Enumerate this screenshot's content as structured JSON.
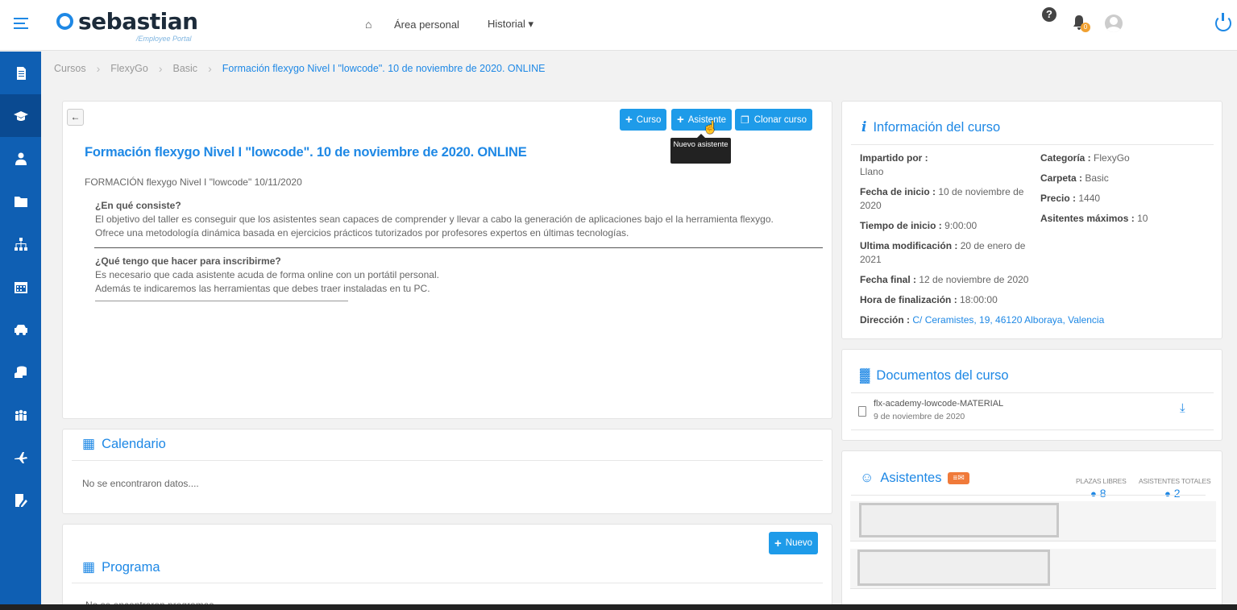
{
  "header": {
    "logo_name": "sebastian",
    "logo_sub": "/Employee Portal",
    "nav": [
      {
        "label": "Área personal"
      },
      {
        "label": "Historial ▾"
      }
    ],
    "help_label": "?",
    "notification_count": "0"
  },
  "sidebar": {
    "items": [
      {
        "icon": "document-icon"
      },
      {
        "icon": "graduation-cap-icon",
        "active": true
      },
      {
        "icon": "user-icon"
      },
      {
        "icon": "folder-icon"
      },
      {
        "icon": "org-chart-icon"
      },
      {
        "icon": "calendar-icon"
      },
      {
        "icon": "car-icon"
      },
      {
        "icon": "coins-icon"
      },
      {
        "icon": "team-icon"
      },
      {
        "icon": "plane-icon"
      },
      {
        "icon": "edit-document-icon"
      }
    ]
  },
  "breadcrumb": {
    "items": [
      "Cursos",
      "FlexyGo",
      "Basic"
    ],
    "current": "Formación flexygo Nivel I \"lowcode\". 10 de noviembre de 2020. ONLINE"
  },
  "course": {
    "buttons": {
      "curso": "Curso",
      "asistente": "Asistente",
      "clonar": "Clonar curso"
    },
    "tooltip": "Nuevo asistente",
    "title": "Formación flexygo Nivel I \"lowcode\". 10 de noviembre de 2020. ONLINE",
    "subtitle": "FORMACIÓN flexygo Nivel I \"lowcode\" 10/11/2020",
    "q1": "¿En qué consiste?",
    "a1_line1": "El objetivo del taller es conseguir que los asistentes sean capaces de comprender y llevar a cabo la generación de aplicaciones bajo el la herramienta flexygo.",
    "a1_line2": "Ofrece una metodología dinámica basada en ejercicios prácticos tutorizados por profesores expertos en últimas tecnologías.",
    "q2": "¿Qué tengo que hacer para inscribirme?",
    "a2_line1": "Es necesario que cada asistente acuda de forma online con un portátil personal.",
    "a2_line2": "Además te indicaremos las herramientas que debes traer instaladas en tu PC."
  },
  "calendar": {
    "title": "Calendario",
    "empty": "No se encontraron datos...."
  },
  "program": {
    "title": "Programa",
    "new_button": "Nuevo",
    "empty": "No se encontraron programas"
  },
  "info": {
    "title": "Información del curso",
    "left": [
      {
        "label": "Impartido por :",
        "value": "Llano"
      },
      {
        "label": "Fecha de inicio :",
        "value": "10 de noviembre de 2020"
      },
      {
        "label": "Tiempo de inicio :",
        "value": "9:00:00"
      },
      {
        "label": "Ultima modificación :",
        "value": "20 de enero de 2021"
      },
      {
        "label": "Fecha final :",
        "value": "12 de noviembre de 2020"
      },
      {
        "label": "Hora de finalización :",
        "value": "18:00:00"
      },
      {
        "label": "Dirección :",
        "value": "C/ Ceramistes, 19, 46120 Alboraya, Valencia"
      }
    ],
    "right": [
      {
        "label": "Categoría :",
        "value": "FlexyGo"
      },
      {
        "label": "Carpeta :",
        "value": "Basic"
      },
      {
        "label": "Precio :",
        "value": "1440"
      },
      {
        "label": "Asitentes máximos :",
        "value": "10"
      }
    ]
  },
  "documents": {
    "title": "Documentos del curso",
    "items": [
      {
        "name": "flx-academy-lowcode-MATERIAL",
        "date": "9 de noviembre de 2020"
      }
    ]
  },
  "attendees": {
    "title": "Asistentes",
    "plazas_label": "PLAZAS LIBRES",
    "plazas_value": "8",
    "totales_label": "ASISTENTES TOTALES",
    "totales_value": "2"
  },
  "colors": {
    "accent": "#1e88e5",
    "sidebar": "#0f5fb3",
    "button": "#1e9be9",
    "badge": "#f07a3a"
  }
}
